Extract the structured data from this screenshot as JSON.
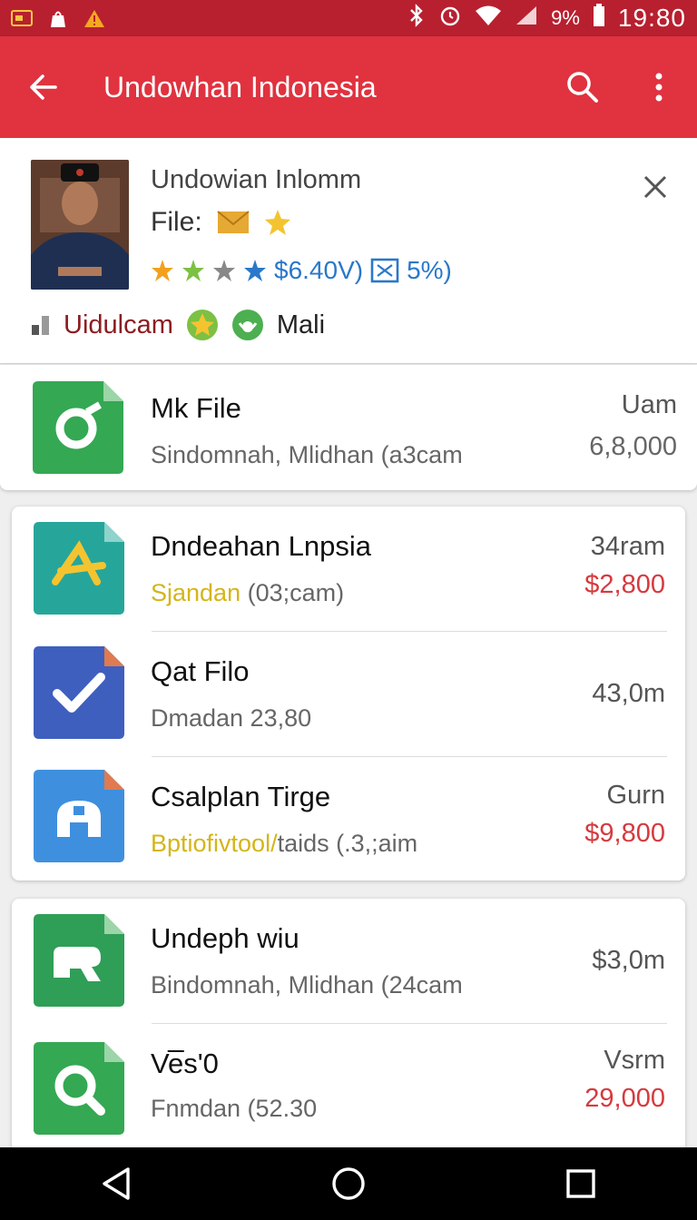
{
  "status_bar": {
    "time": "19:80",
    "battery": "9%"
  },
  "app_bar": {
    "title": "Undowhan Indonesia"
  },
  "profile": {
    "name": "Undowian Inlomm",
    "file_label": "File:",
    "rating_text": "$6.40V)",
    "percent_text": "5%)",
    "tag1": "Uidulcam",
    "tag2": "Mali"
  },
  "items": [
    {
      "title": "Mk File",
      "subtitle": "Sindomnah, Mlidhan (a3cam",
      "right_top": "Uam",
      "right_bottom": "6,8,000",
      "color": "#34a853"
    },
    {
      "title": "Dndeahan Lnpsia",
      "subtitle_highlight": "Sjandan",
      "subtitle": " (03;cam)",
      "right_top": "34ram",
      "right_bottom": "$2,800",
      "color": "#26a69a"
    },
    {
      "title": "Qat Filo",
      "subtitle": "Dmadan  23,80",
      "right_top": "43,0m",
      "color": "#3f5fbf"
    },
    {
      "title": "Csalplan Tirge",
      "subtitle_highlight": "Bptiofivtool/",
      "subtitle": "taids (.3,;aim",
      "right_top": "Gurn",
      "right_bottom": "$9,800",
      "color": "#3f8fdf"
    },
    {
      "title": "Undeph wiu",
      "subtitle": "Bindomnah, Mlidhan (24cam",
      "right_top": "$3,0m",
      "color": "#2f9e57"
    },
    {
      "title": "Ve̅s'0",
      "subtitle": "Fnmdan  (52.30",
      "right_top": "Vsrm",
      "right_bottom": "29,000",
      "color": "#34a853"
    }
  ]
}
